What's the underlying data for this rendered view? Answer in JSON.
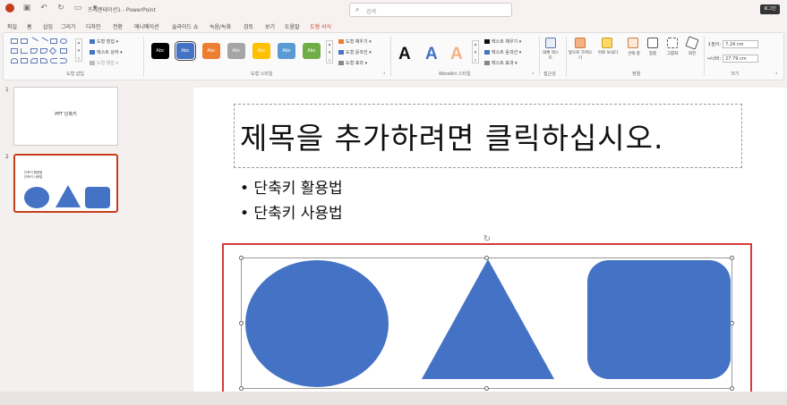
{
  "titlebar": {
    "title": "프레젠테이션1 - PowerPoint",
    "search_placeholder": "검색",
    "login_label": "로그인"
  },
  "menu": {
    "tabs": [
      "파일",
      "홈",
      "삽입",
      "그리기",
      "디자인",
      "전환",
      "애니메이션",
      "슬라이드 쇼",
      "녹음/녹화",
      "검토",
      "보기",
      "도움말",
      "도형 서식"
    ],
    "active": "도형 서식"
  },
  "ribbon": {
    "insert_shapes": {
      "label": "도형 삽입",
      "edit_shape": "도형 편집",
      "text_box": "텍스트 상자",
      "merge_shapes": "도형 병합"
    },
    "shape_styles": {
      "label": "도형 스타일",
      "presets": [
        {
          "text": "Abc",
          "color": "#000000"
        },
        {
          "text": "Abc",
          "color": "#4472c4"
        },
        {
          "text": "Abc",
          "color": "#ed7d31"
        },
        {
          "text": "Abc",
          "color": "#a5a5a5"
        },
        {
          "text": "Abc",
          "color": "#ffc000"
        },
        {
          "text": "Abc",
          "color": "#5b9bd5"
        },
        {
          "text": "Abc",
          "color": "#70ad47"
        }
      ],
      "fill": "도형 채우기",
      "outline": "도형 윤곽선",
      "effects": "도형 효과"
    },
    "wordart": {
      "label": "WordArt 스타일",
      "letter": "A",
      "text_fill": "텍스트 채우기",
      "text_outline": "텍스트 윤곽선",
      "text_effects": "텍스트 효과"
    },
    "accessibility": {
      "label": "접근성",
      "alt_text": "대체 텍스트"
    },
    "arrange": {
      "label": "정렬",
      "bring_forward": "앞으로 가져오기",
      "send_backward": "뒤로 보내기",
      "selection_pane": "선택 창",
      "align": "맞춤",
      "group": "그룹화",
      "rotate": "회전"
    },
    "size": {
      "label": "크기",
      "height_label": "높이:",
      "height_value": "7.24 cm",
      "width_label": "너비:",
      "width_value": "27.79 cm"
    }
  },
  "slides_panel": {
    "slides": [
      {
        "number": "1",
        "text": "PPT 단축키"
      },
      {
        "number": "2",
        "lines": [
          "단축키 활용법",
          "단축키 사용법"
        ]
      }
    ]
  },
  "slide": {
    "title_placeholder": "제목을 추가하려면 클릭하십시오.",
    "bullets": [
      "• 단축키 활용법",
      "• 단축키 사용법"
    ],
    "shape_color": "#4472c4",
    "highlight_color": "#d63b3b"
  }
}
